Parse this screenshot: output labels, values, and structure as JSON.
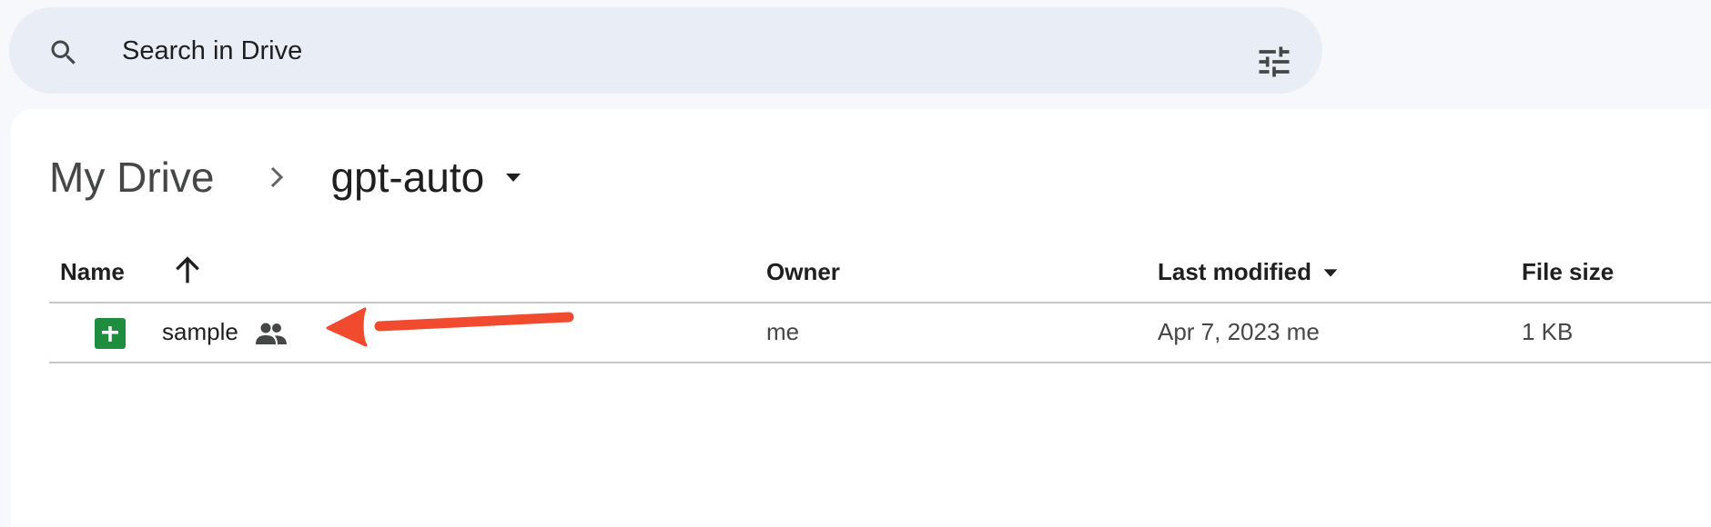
{
  "search": {
    "placeholder": "Search in Drive"
  },
  "breadcrumb": {
    "root": "My Drive",
    "current": "gpt-auto"
  },
  "table": {
    "columns": {
      "name": "Name",
      "owner": "Owner",
      "last_modified": "Last modified",
      "file_size": "File size"
    },
    "sort": {
      "name_direction": "ascending",
      "active_column": "Last modified"
    },
    "rows": [
      {
        "name": "sample",
        "type_icon": "google-sheets-icon",
        "shared": true,
        "owner": "me",
        "last_modified": "Apr 7, 2023 me",
        "file_size": "1 KB"
      }
    ]
  },
  "icons": {
    "search": "search-icon",
    "filter": "tune-icon",
    "breadcrumb_separator": "chevron-right-icon",
    "folder_menu": "caret-down-icon",
    "sort": "arrow-up-icon",
    "shared": "people-icon"
  },
  "colors": {
    "page_background": "#f6f8fc",
    "search_background": "#e9eef6",
    "card_background": "#ffffff",
    "sheets_green": "#1e8e3e",
    "annotation_arrow": "#f24a2e",
    "divider": "#c7c7c7"
  }
}
